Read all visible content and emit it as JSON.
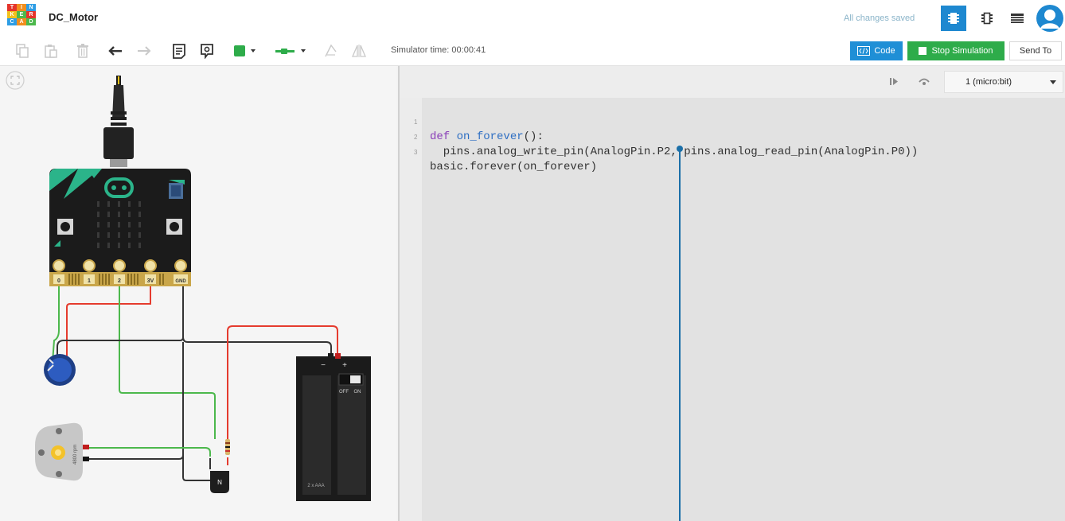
{
  "app": {
    "logo_letters": [
      "T",
      "I",
      "N",
      "K",
      "E",
      "R",
      "C",
      "A",
      "D"
    ],
    "project_title": "DC_Motor",
    "save_status": "All changes saved",
    "views": [
      "circuit-view-icon",
      "component-view-icon",
      "list-view-icon"
    ],
    "avatar_icon": "user-avatar-icon"
  },
  "toolbar": {
    "icons": [
      "copy-icon",
      "paste-icon",
      "delete-icon",
      "undo-icon",
      "redo-icon",
      "note-icon",
      "notes-toggle-icon",
      "color-picker-icon",
      "wire-type-icon",
      "rotate-icon",
      "flip-icon"
    ],
    "wire_color": "#2eac4a",
    "simulator_time": "Simulator time: 00:00:41",
    "code_label": "Code",
    "stop_label": "Stop Simulation",
    "send_label": "Send To"
  },
  "canvas": {
    "pin_labels": [
      "0",
      "1",
      "2",
      "3V",
      "GND"
    ],
    "motor_label": "4800 rpm",
    "transistor_label": "N",
    "battery_minus": "−",
    "battery_plus": "+",
    "switch_off": "OFF",
    "switch_on": "ON",
    "battery_label": "2 x AAA"
  },
  "code_panel": {
    "device": "1 (micro:bit)",
    "line_numbers": [
      "1",
      "2",
      "3"
    ],
    "line1": {
      "kw": "def",
      "fn": "on_forever",
      "rest": "():"
    },
    "line2": "  pins.analog_write_pin(AnalogPin.P2, pins.analog_read_pin(AnalogPin.P0))",
    "line3": "basic.forever(on_forever)"
  },
  "colors": {
    "accent_blue": "#1e88d0",
    "stop_green": "#2eac4a",
    "wire_red": "#e53b2e",
    "wire_green": "#4cb84c",
    "wire_black": "#333333"
  }
}
